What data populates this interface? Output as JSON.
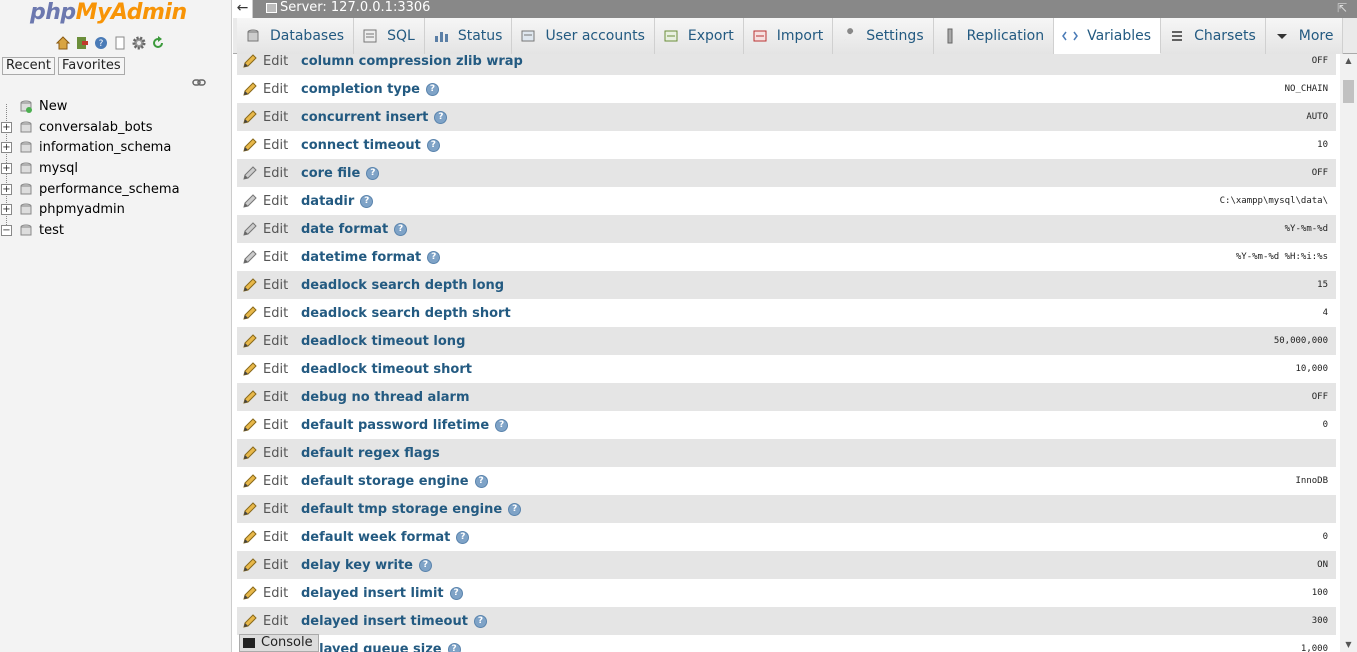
{
  "nav": {
    "logo_part1": "php",
    "logo_part2": "MyAdmin",
    "icons": [
      "home-icon",
      "exit-icon",
      "help-icon",
      "docs-icon",
      "settings-icon",
      "reload-icon"
    ],
    "tabs": [
      "Recent",
      "Favorites"
    ],
    "tree": [
      {
        "label": "New",
        "expander": ""
      },
      {
        "label": "conversalab_bots",
        "expander": "+"
      },
      {
        "label": "information_schema",
        "expander": "+"
      },
      {
        "label": "mysql",
        "expander": "+"
      },
      {
        "label": "performance_schema",
        "expander": "+"
      },
      {
        "label": "phpmyadmin",
        "expander": "+"
      },
      {
        "label": "test",
        "expander": "−"
      }
    ]
  },
  "header": {
    "back": "←",
    "server": "Server: 127.0.0.1:3306",
    "collapse": "⇱"
  },
  "tabs": [
    {
      "label": "Databases",
      "icon": "databases-icon"
    },
    {
      "label": "SQL",
      "icon": "sql-icon"
    },
    {
      "label": "Status",
      "icon": "status-icon"
    },
    {
      "label": "User accounts",
      "icon": "users-icon"
    },
    {
      "label": "Export",
      "icon": "export-icon"
    },
    {
      "label": "Import",
      "icon": "import-icon"
    },
    {
      "label": "Settings",
      "icon": "wrench-icon"
    },
    {
      "label": "Replication",
      "icon": "replication-icon"
    },
    {
      "label": "Variables",
      "icon": "variables-icon",
      "active": true
    },
    {
      "label": "Charsets",
      "icon": "charsets-icon"
    },
    {
      "label": "More",
      "icon": "chevron-down-icon"
    }
  ],
  "edit_label": "Edit",
  "variables": [
    {
      "name": "column compression zlib wrap",
      "value": "OFF",
      "help": false
    },
    {
      "name": "completion type",
      "value": "NO_CHAIN",
      "help": true
    },
    {
      "name": "concurrent insert",
      "value": "AUTO",
      "help": true
    },
    {
      "name": "connect timeout",
      "value": "10",
      "help": true
    },
    {
      "name": "core file",
      "value": "OFF",
      "help": true
    },
    {
      "name": "datadir",
      "value": "C:\\xampp\\mysql\\data\\",
      "help": true
    },
    {
      "name": "date format",
      "value": "%Y-%m-%d",
      "help": true
    },
    {
      "name": "datetime format",
      "value": "%Y-%m-%d %H:%i:%s",
      "help": true
    },
    {
      "name": "deadlock search depth long",
      "value": "15",
      "help": false
    },
    {
      "name": "deadlock search depth short",
      "value": "4",
      "help": false
    },
    {
      "name": "deadlock timeout long",
      "value": "50,000,000",
      "help": false
    },
    {
      "name": "deadlock timeout short",
      "value": "10,000",
      "help": false
    },
    {
      "name": "debug no thread alarm",
      "value": "OFF",
      "help": false
    },
    {
      "name": "default password lifetime",
      "value": "0",
      "help": true
    },
    {
      "name": "default regex flags",
      "value": "",
      "help": false
    },
    {
      "name": "default storage engine",
      "value": "InnoDB",
      "help": true
    },
    {
      "name": "default tmp storage engine",
      "value": "",
      "help": true
    },
    {
      "name": "default week format",
      "value": "0",
      "help": true
    },
    {
      "name": "delay key write",
      "value": "ON",
      "help": true
    },
    {
      "name": "delayed insert limit",
      "value": "100",
      "help": true
    },
    {
      "name": "delayed insert timeout",
      "value": "300",
      "help": true
    },
    {
      "name": "delayed queue size",
      "value": "1,000",
      "help": true
    }
  ],
  "console_label": "Console",
  "colors": {
    "link": "#235a81",
    "accent": "#f89406",
    "logo": "#6c78af"
  }
}
